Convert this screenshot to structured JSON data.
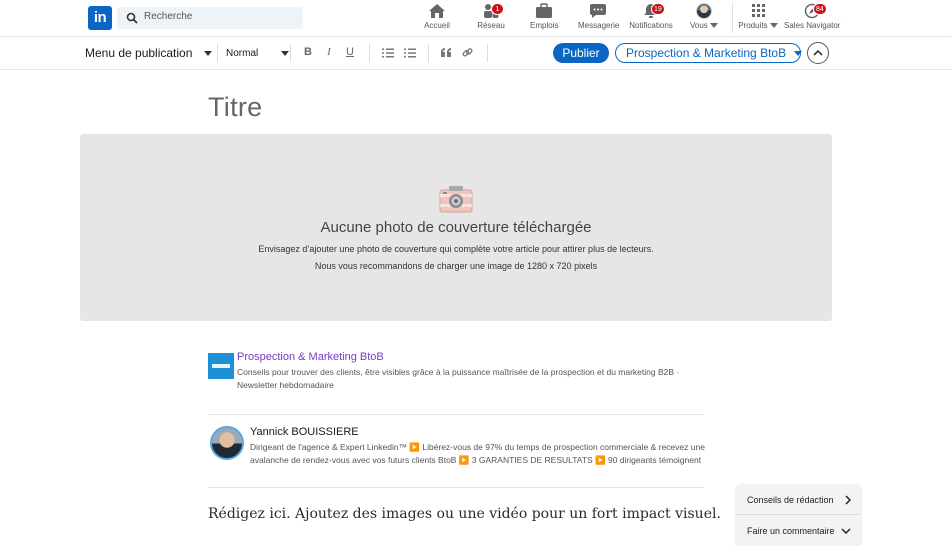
{
  "nav": {
    "search_placeholder": "Recherche",
    "items": [
      {
        "label": "Accueil",
        "icon": "home-icon"
      },
      {
        "label": "Réseau",
        "icon": "network-icon",
        "badge": "1"
      },
      {
        "label": "Emplois",
        "icon": "briefcase-icon"
      },
      {
        "label": "Messagerie",
        "icon": "messaging-icon"
      },
      {
        "label": "Notifications",
        "icon": "bell-icon",
        "badge": "19"
      },
      {
        "label": "Vous",
        "icon": "avatar"
      },
      {
        "label": "Produits",
        "icon": "grid-icon"
      },
      {
        "label": "Sales Navigator",
        "icon": "compass-icon",
        "badge": "84"
      }
    ]
  },
  "toolbar": {
    "menu_label": "Menu de publication",
    "style_value": "Normal",
    "format_buttons": [
      "B",
      "I",
      "U"
    ],
    "publish_label": "Publier",
    "newsletter_label": "Prospection & Marketing BtoB"
  },
  "article": {
    "title_placeholder": "Titre",
    "cover": {
      "heading": "Aucune photo de couverture téléchargée",
      "line1": "Envisagez d’ajouter une photo de couverture qui complète votre article pour attirer plus de lecteurs.",
      "line2": "Nous vous recommandons de charger une image de 1280 x 720 pixels"
    },
    "newsletter": {
      "name": "Prospection & Marketing BtoB",
      "description": "Conseils pour trouver des clients, être visibles grâce à la puissance maîtrisée de la prospection et du marketing B2B · Newsletter hebdomadaire"
    },
    "author": {
      "name": "Yannick BOUISSIERE",
      "bio": "Dirigeant de l'agence & Expert Linkedin™ ▶️ Libérez-vous de 97% du temps de prospection commerciale & recevez une avalanche de rendez-vous avec vos futurs clients BtoB ▶️ 3 GARANTIES DE RESULTATS ▶️ 90 dirigeants témoignent"
    },
    "body_placeholder": "Rédigez ici. Ajoutez des images ou une vidéo pour un fort impact visuel."
  },
  "help": {
    "tips_label": "Conseils de rédaction",
    "comment_label": "Faire un commentaire"
  },
  "colors": {
    "brand": "#0a66c2",
    "newsletter_title": "#7a3cc4",
    "badge": "#cc1016"
  }
}
